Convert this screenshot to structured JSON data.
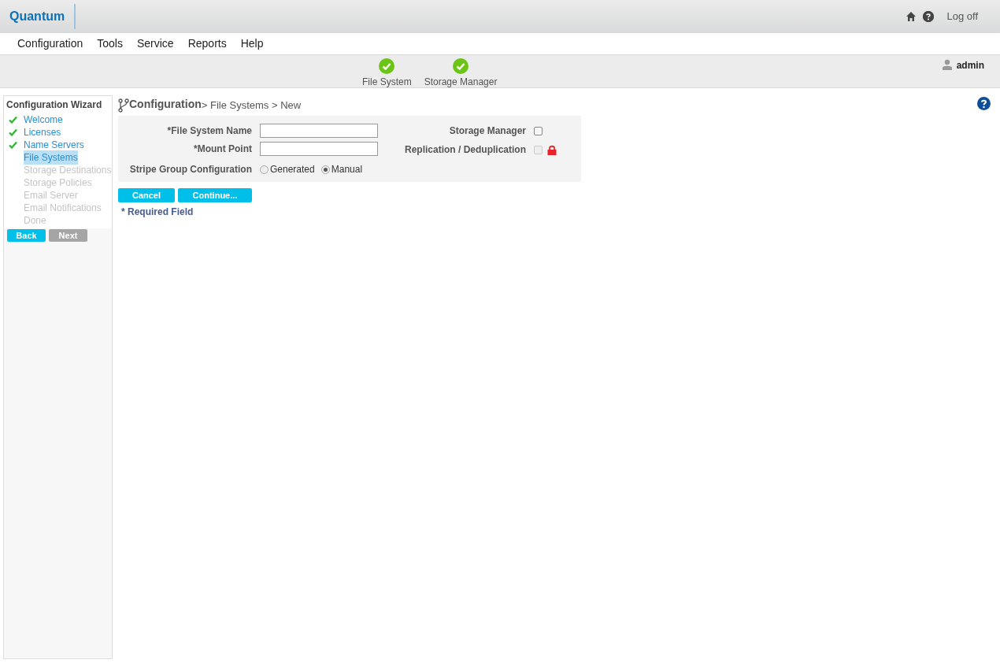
{
  "header": {
    "logo": "Quantum",
    "log_off": "Log off"
  },
  "menu": [
    {
      "label": "Configuration"
    },
    {
      "label": "Tools"
    },
    {
      "label": "Service"
    },
    {
      "label": "Reports"
    },
    {
      "label": "Help"
    }
  ],
  "status": {
    "items": [
      {
        "label": "File System",
        "ok": true
      },
      {
        "label": "Storage Manager",
        "ok": true
      }
    ],
    "user": "admin"
  },
  "wizard": {
    "title": "Configuration Wizard",
    "steps": [
      {
        "label": "Welcome",
        "done": true,
        "selected": false,
        "disabled": false
      },
      {
        "label": "Licenses",
        "done": true,
        "selected": false,
        "disabled": false
      },
      {
        "label": "Name Servers",
        "done": true,
        "selected": false,
        "disabled": false
      },
      {
        "label": "File Systems",
        "done": false,
        "selected": true,
        "disabled": false
      },
      {
        "label": "Storage Destinations",
        "done": false,
        "selected": false,
        "disabled": true
      },
      {
        "label": "Storage Policies",
        "done": false,
        "selected": false,
        "disabled": true
      },
      {
        "label": "Email Server",
        "done": false,
        "selected": false,
        "disabled": true
      },
      {
        "label": "Email Notifications",
        "done": false,
        "selected": false,
        "disabled": true
      },
      {
        "label": "Done",
        "done": false,
        "selected": false,
        "disabled": true
      }
    ],
    "buttons": [
      {
        "label": "Back",
        "disabled": false
      },
      {
        "label": "Next",
        "disabled": true
      }
    ]
  },
  "breadcrumb": {
    "root": "Configuration",
    "rest": "> File Systems > New"
  },
  "form": {
    "fields": [
      {
        "label": "*File System Name"
      },
      {
        "label": "*Mount Point"
      }
    ],
    "stripe": {
      "label": "Stripe Group Configuration",
      "options": [
        {
          "label": "Generated",
          "selected": false
        },
        {
          "label": "Manual",
          "selected": true
        }
      ]
    },
    "checks": [
      {
        "label": "Storage Manager",
        "checked": false,
        "locked": false
      },
      {
        "label": "Replication / Deduplication",
        "checked": false,
        "locked": true
      }
    ]
  },
  "actions": [
    {
      "label": "Cancel"
    },
    {
      "label": "Continue..."
    }
  ],
  "required_note": "* Required Field"
}
